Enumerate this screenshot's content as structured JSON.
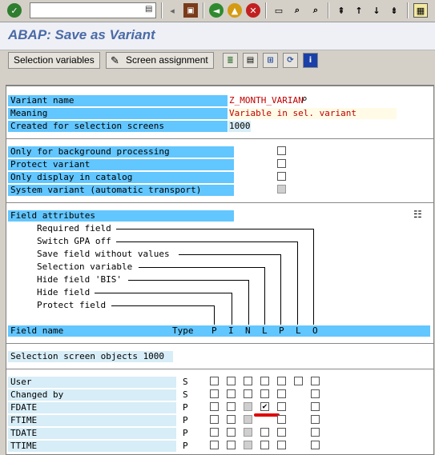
{
  "toolbar": {
    "command_field_value": "",
    "icons": [
      "enter-icon",
      "save-icon",
      "back-icon",
      "exit-icon",
      "cancel-icon",
      "print-icon",
      "find-icon",
      "find-next-icon",
      "first-page-icon",
      "previous-page-icon",
      "next-page-icon",
      "last-page-icon",
      "create-session-icon"
    ]
  },
  "title": "ABAP: Save as Variant",
  "app_toolbar": {
    "selection_variables": "Selection variables",
    "screen_assignment": "Screen assignment"
  },
  "variant": {
    "name_label": "Variant name",
    "name_value": "Z_MONTH_VARIAN",
    "meaning_label": "Meaning",
    "meaning_value": "Variable in sel. variant",
    "created_label": "Created for selection screens",
    "created_value": "1000"
  },
  "options": [
    {
      "label": "Only for background processing",
      "checked": false,
      "disabled": false
    },
    {
      "label": "Protect variant",
      "checked": false,
      "disabled": false
    },
    {
      "label": "Only display in catalog",
      "checked": false,
      "disabled": false
    },
    {
      "label": "System variant (automatic transport)",
      "checked": false,
      "disabled": true
    }
  ],
  "field_attributes": {
    "header": "Field attributes",
    "items": [
      "Required field",
      "Switch GPA off",
      "Save field without values",
      "Selection variable",
      "Hide field 'BIS'",
      "Hide field",
      "Protect field"
    ],
    "col_field_name": "Field name",
    "col_type": "Type",
    "col_letters": [
      "P",
      "I",
      "N",
      "L",
      "P",
      "L",
      "O"
    ]
  },
  "objects_header": "Selection screen objects 1000",
  "rows": [
    {
      "name": "User",
      "type": "S"
    },
    {
      "name": "Changed by",
      "type": "S"
    },
    {
      "name": "FDATE",
      "type": "P"
    },
    {
      "name": "FTIME",
      "type": "P"
    },
    {
      "name": "TDATE",
      "type": "P"
    },
    {
      "name": "TTIME",
      "type": "P"
    }
  ],
  "colors": {
    "label_bg": "#62c6ff",
    "light_label_bg": "#d7edf7",
    "title_color": "#4a6aa6",
    "highlight_mark": "#e00000"
  }
}
